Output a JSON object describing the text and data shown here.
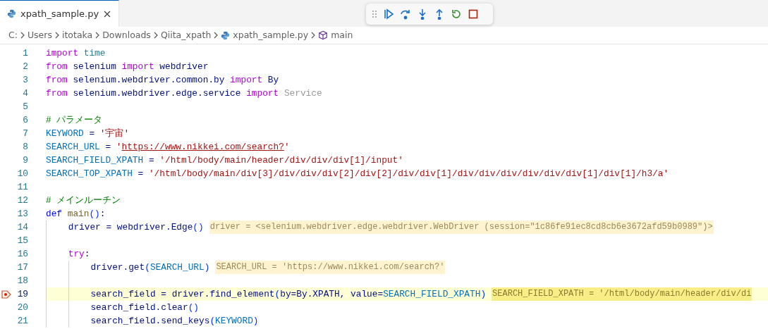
{
  "tabs": [
    {
      "label": "xpath_sample.py",
      "selected": true
    }
  ],
  "breadcrumbs": [
    {
      "kind": "folder",
      "label": "C:"
    },
    {
      "kind": "folder",
      "label": "Users"
    },
    {
      "kind": "folder",
      "label": "itotaka"
    },
    {
      "kind": "folder",
      "label": "Downloads"
    },
    {
      "kind": "folder",
      "label": "Qiita_xpath"
    },
    {
      "kind": "python",
      "label": "xpath_sample.py"
    },
    {
      "kind": "symbol",
      "label": "main"
    }
  ],
  "lines": [
    {
      "number": "1",
      "current": false,
      "breakpoint": false,
      "tokens": [
        {
          "kind": "keyword",
          "text": "import "
        },
        {
          "kind": "module",
          "text": "time"
        }
      ]
    },
    {
      "number": "2",
      "current": false,
      "breakpoint": false,
      "tokens": [
        {
          "kind": "keyword",
          "text": "from"
        },
        {
          "kind": "plain",
          "text": " selenium "
        },
        {
          "kind": "keyword",
          "text": "import"
        },
        {
          "kind": "plain",
          "text": " webdriver"
        }
      ]
    },
    {
      "number": "3",
      "current": false,
      "breakpoint": false,
      "tokens": [
        {
          "kind": "keyword",
          "text": "from"
        },
        {
          "kind": "plain",
          "text": " selenium.webdriver.common.by "
        },
        {
          "kind": "keyword",
          "text": "import"
        },
        {
          "kind": "plain",
          "text": " By"
        }
      ]
    },
    {
      "number": "4",
      "current": false,
      "breakpoint": false,
      "tokens": [
        {
          "kind": "keyword",
          "text": "from"
        },
        {
          "kind": "plain",
          "text": " selenium.webdriver.edge.service "
        },
        {
          "kind": "keyword",
          "text": "import "
        },
        {
          "kind": "faded",
          "text": "Service"
        }
      ]
    },
    {
      "number": "5",
      "current": false,
      "breakpoint": false
    },
    {
      "number": "6",
      "current": false,
      "breakpoint": false,
      "tokens": [
        {
          "kind": "comment",
          "text": "# パラメータ"
        }
      ]
    },
    {
      "number": "7",
      "current": false,
      "breakpoint": false,
      "tokens": [
        {
          "kind": "variable",
          "text": "KEYWORD"
        },
        {
          "kind": "plain",
          "text": " = "
        },
        {
          "kind": "string",
          "text": "'宇宙'"
        }
      ]
    },
    {
      "number": "8",
      "current": false,
      "breakpoint": false,
      "tokens": [
        {
          "kind": "variable",
          "text": "SEARCH_URL"
        },
        {
          "kind": "plain",
          "text": " = "
        },
        {
          "kind": "string",
          "text": "'"
        },
        {
          "kind": "link",
          "text": "https://www.nikkei.com/search?"
        },
        {
          "kind": "string",
          "text": "'"
        }
      ]
    },
    {
      "number": "9",
      "current": false,
      "breakpoint": false,
      "tokens": [
        {
          "kind": "variable",
          "text": "SEARCH_FIELD_XPATH"
        },
        {
          "kind": "plain",
          "text": " = "
        },
        {
          "kind": "string",
          "text": "'/html/body/main/header/div/div/div[1]/input'"
        }
      ]
    },
    {
      "number": "10",
      "current": false,
      "breakpoint": false,
      "tokens": [
        {
          "kind": "variable",
          "text": "SEARCH_TOP_XPATH"
        },
        {
          "kind": "plain",
          "text": " = "
        },
        {
          "kind": "string",
          "text": "'/html/body/main/div[3]/div/div/div[2]/div[2]/div/div[1]/div/div/div/div/div/div[1]/div[1]/h3/a'"
        }
      ]
    },
    {
      "number": "11",
      "current": false,
      "breakpoint": false
    },
    {
      "number": "12",
      "current": false,
      "breakpoint": false,
      "tokens": [
        {
          "kind": "comment",
          "text": "# メインルーチン"
        }
      ]
    },
    {
      "number": "13",
      "current": false,
      "breakpoint": false,
      "tokens": [
        {
          "kind": "storage",
          "text": "def "
        },
        {
          "kind": "function",
          "text": "main"
        },
        {
          "kind": "bracket",
          "text": "()"
        },
        {
          "kind": "plain",
          "text": ":"
        }
      ],
      "children": [
        {
          "number": "14",
          "current": false,
          "breakpoint": false,
          "tokens": [
            {
              "kind": "plain",
              "text": "driver = webdriver.Edge"
            },
            {
              "kind": "bracket",
              "text": "()"
            }
          ],
          "hint": "driver = <selenium.webdriver.edge.webdriver.WebDriver (session=\"1c86fe91ec8cd8cb6e3672afd59b0989\")>"
        },
        {
          "number": "15",
          "current": false,
          "breakpoint": false
        },
        {
          "number": "16",
          "current": false,
          "breakpoint": false,
          "tokens": [
            {
              "kind": "keyword",
              "text": "try"
            },
            {
              "kind": "plain",
              "text": ":"
            }
          ],
          "children": [
            {
              "number": "17",
              "current": false,
              "breakpoint": false,
              "tokens": [
                {
                  "kind": "plain",
                  "text": "driver.get"
                },
                {
                  "kind": "bracket",
                  "text": "("
                },
                {
                  "kind": "variable",
                  "text": "SEARCH_URL"
                },
                {
                  "kind": "bracket",
                  "text": ")"
                }
              ],
              "hint": "SEARCH_URL = 'https://www.nikkei.com/search?'"
            },
            {
              "number": "18",
              "current": false,
              "breakpoint": false
            },
            {
              "number": "19",
              "current": true,
              "breakpoint": true,
              "tokens": [
                {
                  "kind": "plain",
                  "text": "search_field = driver.find_element"
                },
                {
                  "kind": "bracket",
                  "text": "("
                },
                {
                  "kind": "plain",
                  "text": "by=By.XPATH, value="
                },
                {
                  "kind": "variable",
                  "text": "SEARCH_FIELD_XPATH"
                },
                {
                  "kind": "bracket",
                  "text": ")"
                }
              ],
              "hint": "SEARCH_FIELD_XPATH = '/html/body/main/header/div/di"
            },
            {
              "number": "20",
              "current": false,
              "breakpoint": false,
              "tokens": [
                {
                  "kind": "plain",
                  "text": "search_field.clear"
                },
                {
                  "kind": "bracket",
                  "text": "()"
                }
              ]
            },
            {
              "number": "21",
              "current": false,
              "breakpoint": false,
              "tokens": [
                {
                  "kind": "plain",
                  "text": "search_field.send_keys"
                },
                {
                  "kind": "bracket",
                  "text": "("
                },
                {
                  "kind": "variable",
                  "text": "KEYWORD"
                },
                {
                  "kind": "bracket",
                  "text": ")"
                }
              ]
            }
          ]
        }
      ]
    }
  ]
}
